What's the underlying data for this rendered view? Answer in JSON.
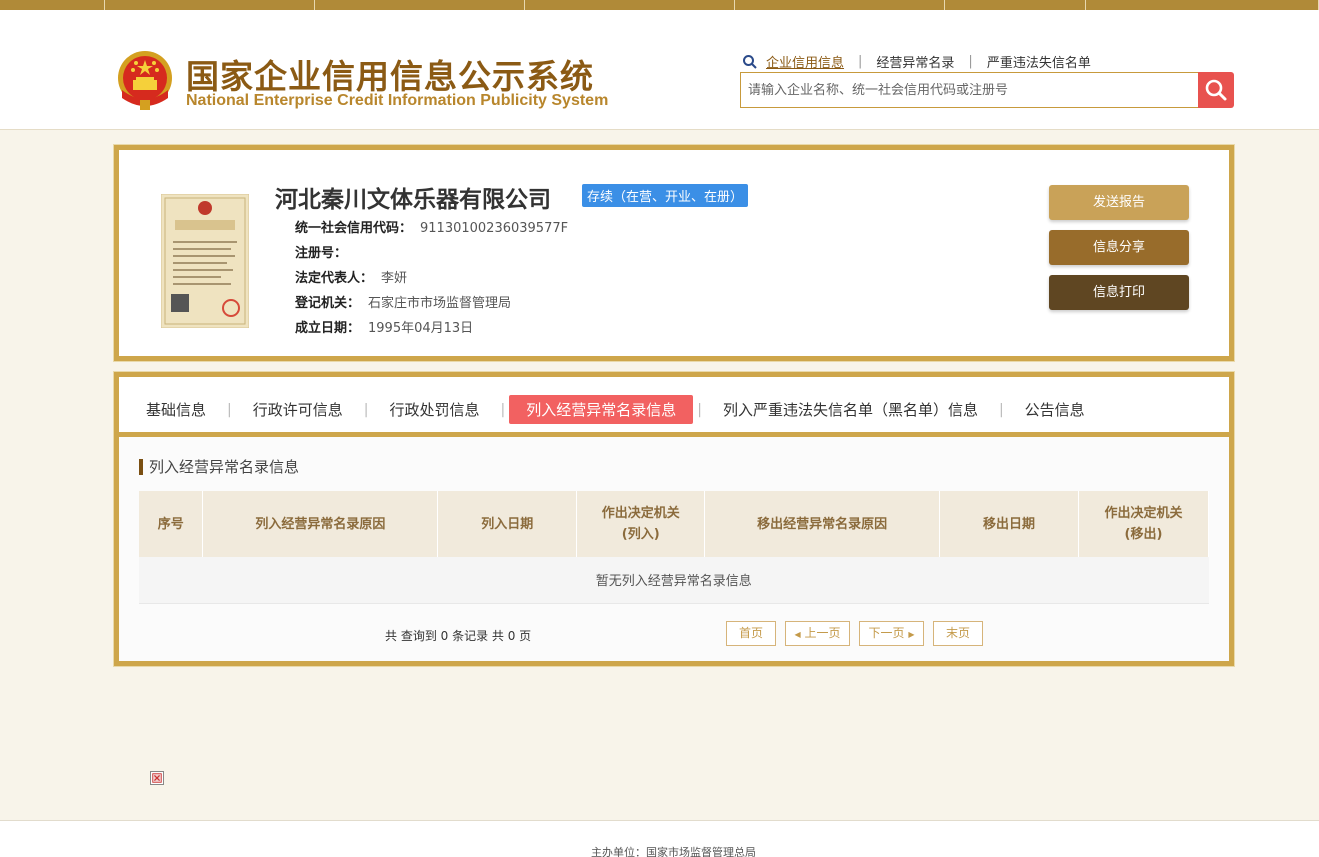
{
  "header": {
    "logo_cn": "国家企业信用信息公示系统",
    "logo_en": "National Enterprise Credit Information Publicity System",
    "search_links": [
      "企业信用信息",
      "经营异常名录",
      "严重违法失信名单"
    ],
    "search_placeholder": "请输入企业名称、统一社会信用代码或注册号"
  },
  "company": {
    "name": "河北秦川文体乐器有限公司",
    "status": "存续（在营、开业、在册）",
    "fields": [
      {
        "label": "统一社会信用代码：",
        "value": "91130100236039577F"
      },
      {
        "label": "注册号：",
        "value": ""
      },
      {
        "label": "法定代表人：",
        "value": "李妍"
      },
      {
        "label": "登记机关：",
        "value": "石家庄市市场监督管理局"
      },
      {
        "label": "成立日期：",
        "value": "1995年04月13日"
      }
    ],
    "license_title": "营业执照"
  },
  "actions": {
    "send_report": "发送报告",
    "share": "信息分享",
    "print": "信息打印"
  },
  "tabs": [
    "基础信息",
    "行政许可信息",
    "行政处罚信息",
    "列入经营异常名录信息",
    "列入严重违法失信名单（黑名单）信息",
    "公告信息"
  ],
  "active_tab": 3,
  "section": {
    "title": "列入经营异常名录信息",
    "columns": [
      "序号",
      "列入经营异常名录原因",
      "列入日期",
      "作出决定机关\n(列入)",
      "移出经营异常名录原因",
      "移出日期",
      "作出决定机关\n(移出)"
    ],
    "empty_text": "暂无列入经营异常名录信息"
  },
  "pager": {
    "summary": "共 查询到 0 条记录 共 0 页",
    "first": "首页",
    "prev": "上一页",
    "next": "下一页",
    "last": "末页"
  },
  "footer": {
    "text": "主办单位：国家市场监督管理总局"
  },
  "colors": {
    "brand_gold": "#cea64b",
    "brand_brown": "#8b5a14",
    "status_blue": "#3b8fe6",
    "active_tab_red": "#f26161",
    "search_red": "#e8524f"
  }
}
